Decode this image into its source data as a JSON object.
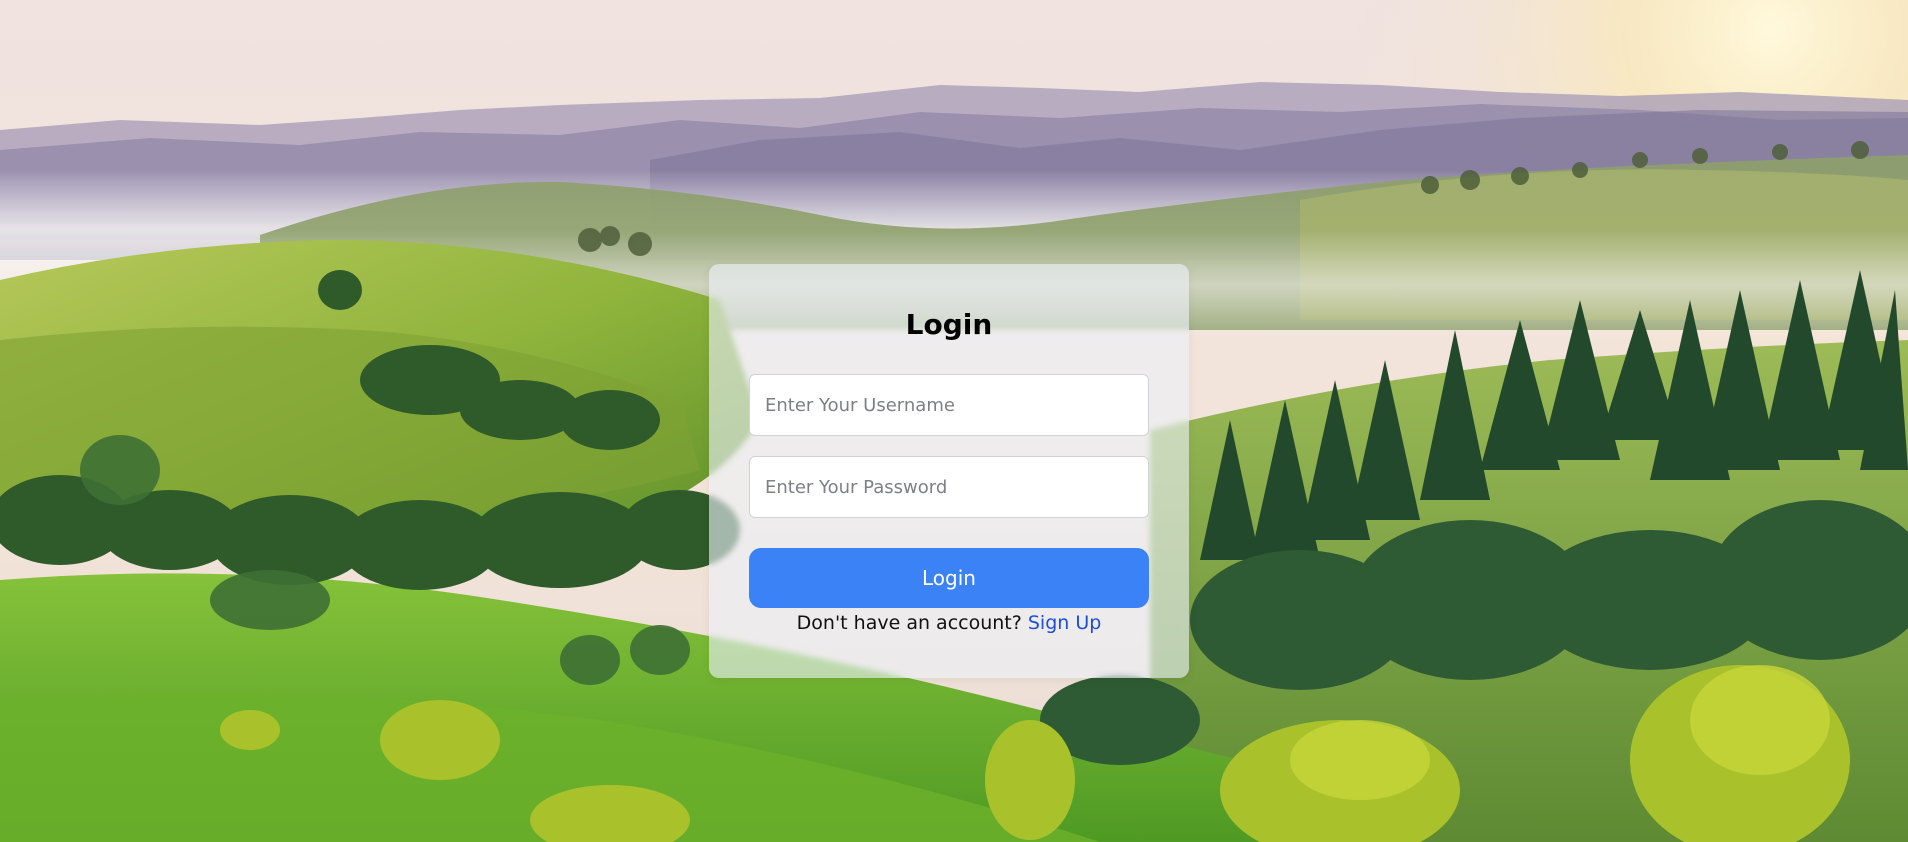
{
  "login": {
    "title": "Login",
    "username_placeholder": "Enter Your Username",
    "password_placeholder": "Enter Your Password",
    "button_label": "Login",
    "signup_prompt": "Don't have an account?",
    "signup_link": "Sign Up"
  },
  "colors": {
    "primary_button": "#3b82f6",
    "link": "#1d4ed8",
    "card_background": "rgba(235,240,248,0.62)"
  },
  "background": {
    "subject": "green hills with pine forest and misty mountains at sunrise"
  }
}
